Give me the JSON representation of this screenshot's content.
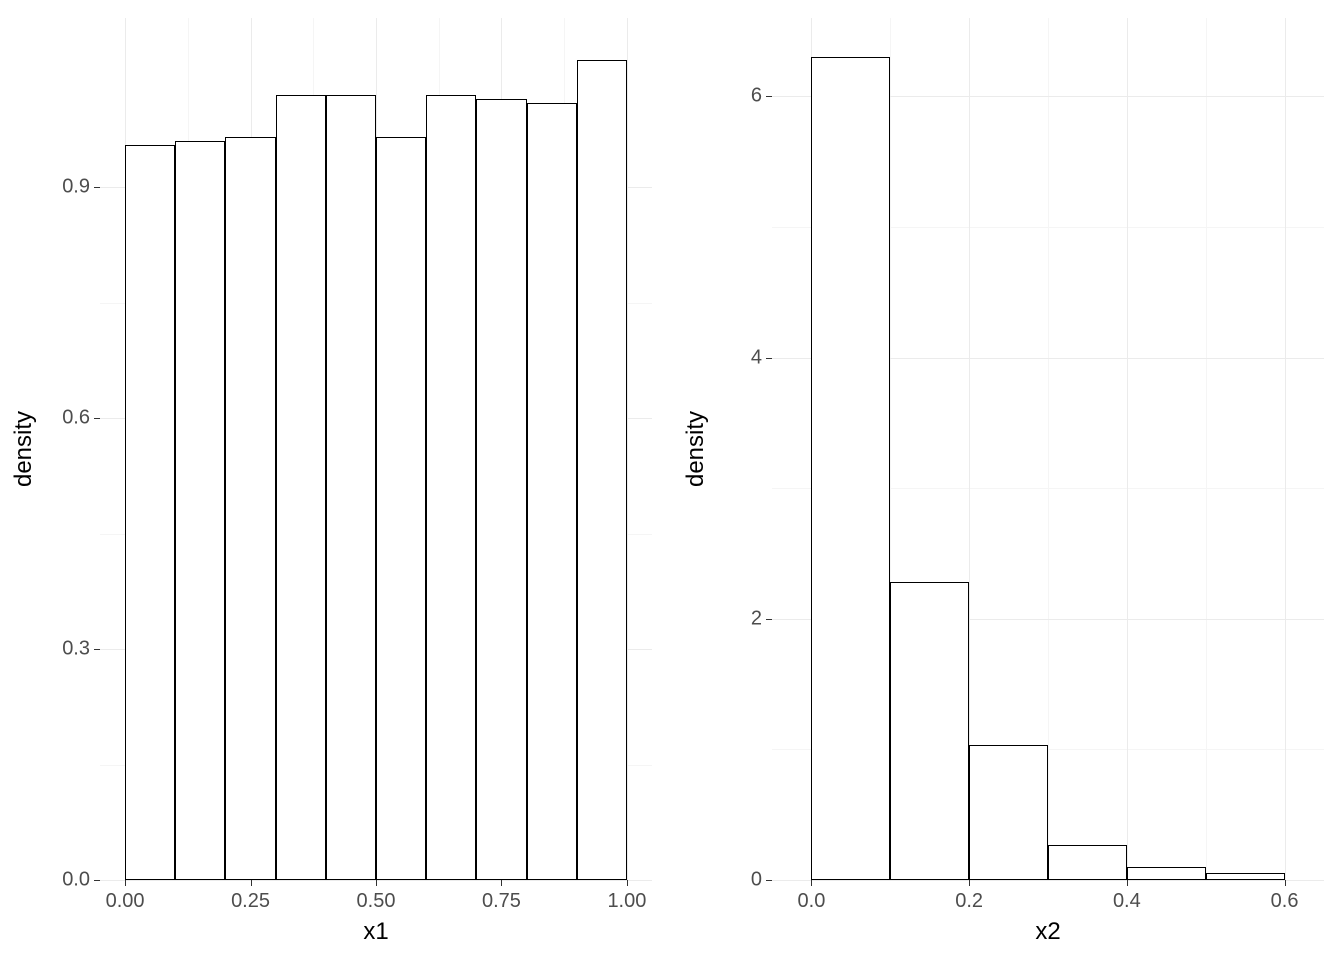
{
  "chart_data": [
    {
      "type": "bar",
      "xlabel": "x1",
      "ylabel": "density",
      "title": "",
      "xlim": [
        -0.05,
        1.05
      ],
      "ylim": [
        0,
        1.12
      ],
      "x_ticks": [
        0.0,
        0.25,
        0.5,
        0.75,
        1.0
      ],
      "x_tick_labels": [
        "0.00",
        "0.25",
        "0.50",
        "0.75",
        "1.00"
      ],
      "y_ticks": [
        0.0,
        0.3,
        0.6,
        0.9
      ],
      "y_tick_labels": [
        "0.0",
        "0.3",
        "0.6",
        "0.9"
      ],
      "bin_edges": [
        0.0,
        0.1,
        0.2,
        0.3,
        0.4,
        0.5,
        0.6,
        0.7,
        0.8,
        0.9,
        1.0
      ],
      "values": [
        0.955,
        0.96,
        0.965,
        1.02,
        1.02,
        0.965,
        1.02,
        1.015,
        1.01,
        1.065
      ]
    },
    {
      "type": "bar",
      "xlabel": "x2",
      "ylabel": "density",
      "title": "",
      "xlim": [
        -0.05,
        0.65
      ],
      "ylim": [
        0,
        6.6
      ],
      "x_ticks": [
        0.0,
        0.2,
        0.4,
        0.6
      ],
      "x_tick_labels": [
        "0.0",
        "0.2",
        "0.4",
        "0.6"
      ],
      "y_ticks": [
        0,
        2,
        4,
        6
      ],
      "y_tick_labels": [
        "0",
        "2",
        "4",
        "6"
      ],
      "bin_edges": [
        0.0,
        0.1,
        0.2,
        0.3,
        0.4,
        0.5,
        0.6
      ],
      "values": [
        6.3,
        2.28,
        1.03,
        0.27,
        0.1,
        0.05
      ]
    }
  ]
}
